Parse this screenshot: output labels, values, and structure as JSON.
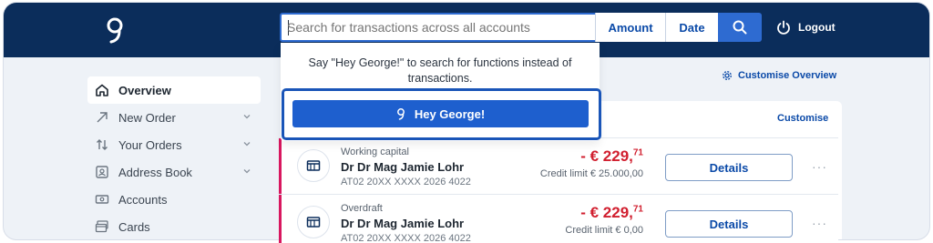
{
  "search": {
    "placeholder": "Search for transactions across all accounts",
    "amount_label": "Amount",
    "date_label": "Date"
  },
  "header": {
    "logout_label": "Logout"
  },
  "dropdown": {
    "hint": "Say \"Hey George!\" to search for functions instead of transactions.",
    "george_button_label": "Hey George!"
  },
  "sidebar": {
    "items": [
      {
        "label": "Overview",
        "icon": "home-icon",
        "active": true
      },
      {
        "label": "New Order",
        "icon": "arrow-up-right-icon",
        "expandable": true
      },
      {
        "label": "Your Orders",
        "icon": "transfer-arrows-icon",
        "expandable": true
      },
      {
        "label": "Address Book",
        "icon": "contact-card-icon",
        "expandable": true
      },
      {
        "label": "Accounts",
        "icon": "money-icon"
      },
      {
        "label": "Cards",
        "icon": "cards-icon"
      }
    ]
  },
  "main": {
    "customise_overview_label": "Customise Overview",
    "customise_label": "Customise",
    "accounts": [
      {
        "type": "Working capital",
        "name": "Dr Dr Mag Jamie Lohr",
        "iban": "AT02 20XX XXXX 2026 4022",
        "amount_main": "- € 229,",
        "amount_cents": "71",
        "credit_limit": "Credit limit € 25.000,00",
        "details_label": "Details",
        "more_label": "···"
      },
      {
        "type": "Overdraft",
        "name": "Dr Dr Mag Jamie Lohr",
        "iban": "AT02 20XX XXXX 2026 4022",
        "amount_main": "- € 229,",
        "amount_cents": "71",
        "credit_limit": "Credit limit € 0,00",
        "details_label": "Details",
        "more_label": "···"
      }
    ]
  },
  "colors": {
    "header_bg": "#0b2d5b",
    "accent_blue": "#1e5fce",
    "negative_red": "#d11f2f",
    "stripe_pink": "#d8175f"
  }
}
